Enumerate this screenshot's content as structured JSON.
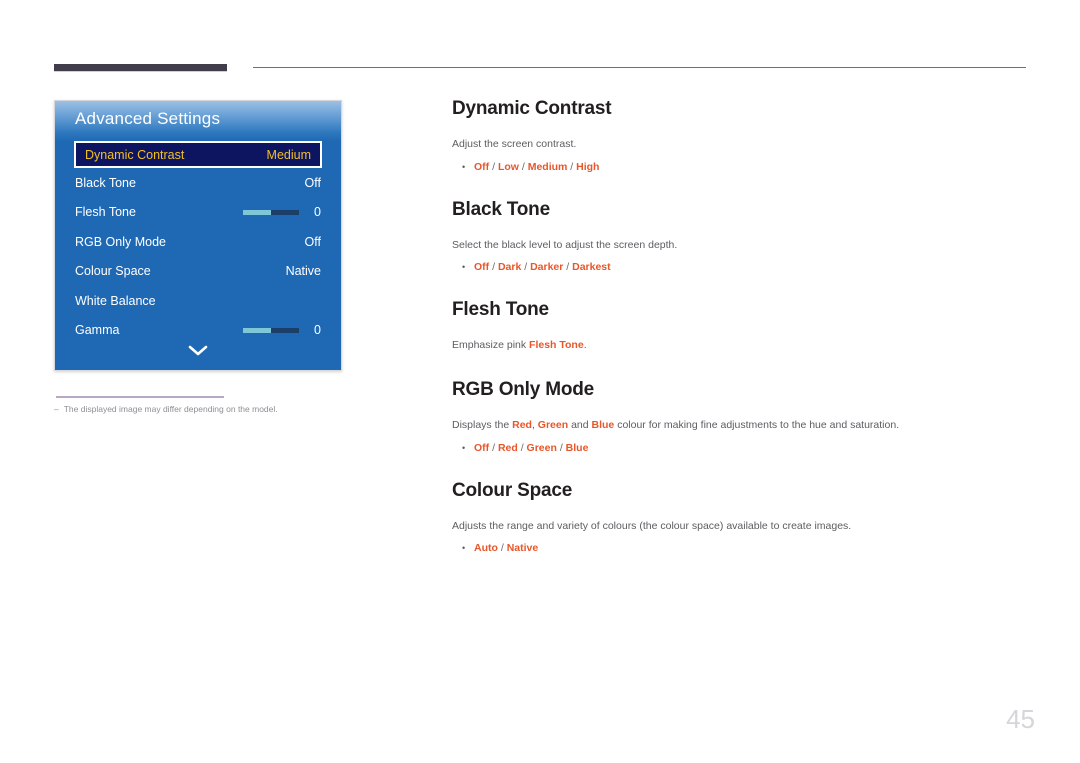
{
  "page": {
    "number": "45"
  },
  "osd": {
    "title": "Advanced Settings",
    "scroll_icon": "chevron-down-icon",
    "rows": [
      {
        "label": "Dynamic Contrast",
        "value": "Medium",
        "type": "value",
        "selected": true
      },
      {
        "label": "Black Tone",
        "value": "Off",
        "type": "value",
        "selected": false
      },
      {
        "label": "Flesh Tone",
        "value": "0",
        "type": "slider",
        "fill_percent": 50,
        "selected": false
      },
      {
        "label": "RGB Only Mode",
        "value": "Off",
        "type": "value",
        "selected": false
      },
      {
        "label": "Colour Space",
        "value": "Native",
        "type": "value",
        "selected": false
      },
      {
        "label": "White Balance",
        "value": "",
        "type": "value",
        "selected": false
      },
      {
        "label": "Gamma",
        "value": "0",
        "type": "slider",
        "fill_percent": 50,
        "selected": false
      }
    ]
  },
  "footnote": {
    "dash": "‒",
    "text": "The displayed image may differ depending on the model."
  },
  "sections": [
    {
      "title": "Dynamic Contrast",
      "desc_prefix": "Adjust the screen contrast.",
      "desc_parts": [],
      "bullet": "•",
      "options": [
        "Off",
        "Low",
        "Medium",
        "High"
      ]
    },
    {
      "title": "Black Tone",
      "desc_prefix": "Select the black level to adjust the screen depth.",
      "desc_parts": [],
      "bullet": "•",
      "options": [
        "Off",
        "Dark",
        "Darker",
        "Darkest"
      ]
    },
    {
      "title": "Flesh Tone",
      "desc_prefix": "Emphasize pink ",
      "desc_parts": [
        {
          "text": "Flesh Tone",
          "highlight": true
        },
        {
          "text": ".",
          "highlight": false
        }
      ],
      "bullet": "",
      "options": []
    },
    {
      "title": "RGB Only Mode",
      "desc_prefix": "Displays the ",
      "desc_parts": [
        {
          "text": "Red",
          "highlight": true
        },
        {
          "text": ", ",
          "highlight": false
        },
        {
          "text": "Green",
          "highlight": true
        },
        {
          "text": " and ",
          "highlight": false
        },
        {
          "text": "Blue",
          "highlight": true
        },
        {
          "text": " colour for making fine adjustments to the hue and saturation.",
          "highlight": false
        }
      ],
      "bullet": "•",
      "options": [
        "Off",
        "Red",
        "Green",
        "Blue"
      ]
    },
    {
      "title": "Colour Space",
      "desc_prefix": "Adjusts the range and variety of colours (the colour space) available to create images.",
      "desc_parts": [],
      "bullet": "•",
      "options": [
        "Auto",
        "Native"
      ]
    }
  ],
  "colors": {
    "osd_blue": "#1f68b4",
    "osd_selected_bg": "#0d1560",
    "osd_selected_text": "#f2c021",
    "slider_fill": "#7fc6d6",
    "slider_track": "#1b3f68",
    "accent_orange": "#e8562a",
    "heading_dark": "#231f20",
    "rule_dark": "#413d4b"
  }
}
